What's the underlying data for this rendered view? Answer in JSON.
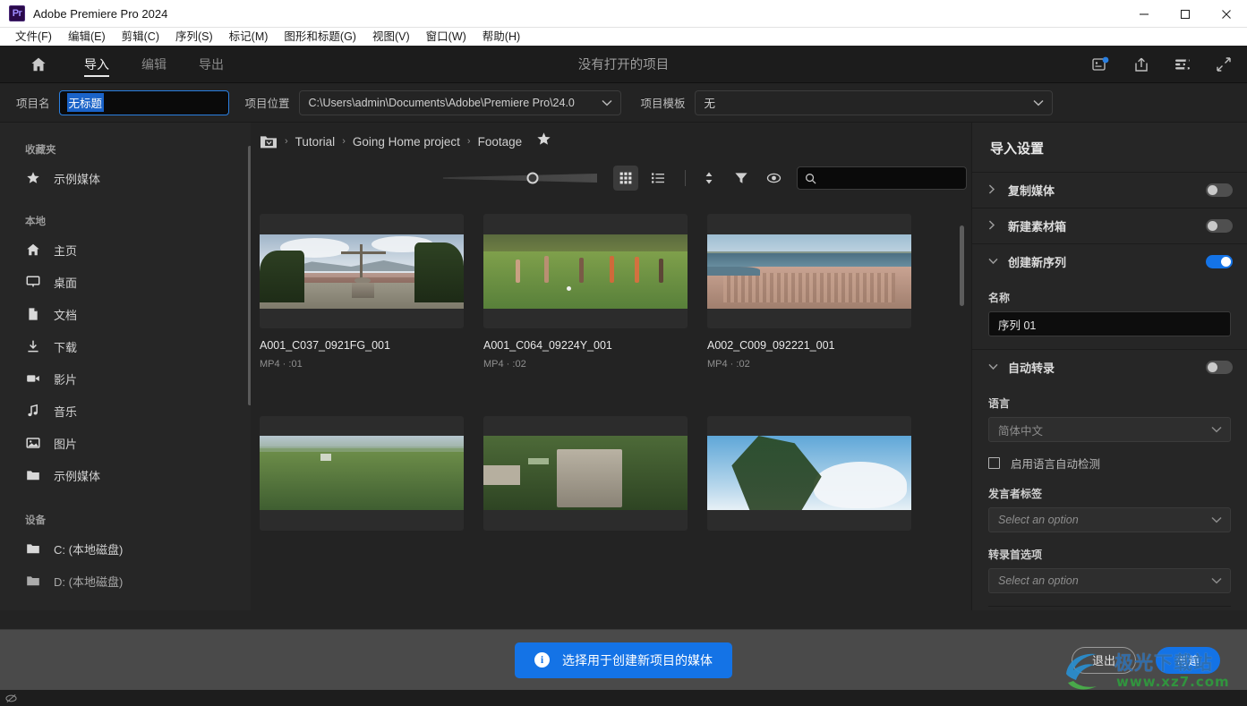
{
  "window": {
    "app_title": "Adobe Premiere Pro 2024",
    "logo_text": "Pr",
    "minimize": "minimize-icon",
    "maximize": "maximize-icon",
    "close": "close-icon"
  },
  "menubar": {
    "items": [
      {
        "label": "文件(F)"
      },
      {
        "label": "编辑(E)"
      },
      {
        "label": "剪辑(C)"
      },
      {
        "label": "序列(S)"
      },
      {
        "label": "标记(M)"
      },
      {
        "label": "图形和标题(G)"
      },
      {
        "label": "视图(V)"
      },
      {
        "label": "窗口(W)"
      },
      {
        "label": "帮助(H)"
      }
    ]
  },
  "header": {
    "home_icon": "home-icon",
    "tabs": [
      {
        "label": "导入",
        "active": true
      },
      {
        "label": "编辑",
        "active": false
      },
      {
        "label": "导出",
        "active": false
      }
    ],
    "center_title": "没有打开的项目",
    "right_icons": [
      "notifications-icon",
      "share-icon",
      "progress-icon",
      "fullscreen-icon"
    ]
  },
  "projectbar": {
    "name_label": "项目名",
    "name_value": "无标题",
    "location_label": "项目位置",
    "location_value": "C:\\Users\\admin\\Documents\\Adobe\\Premiere Pro\\24.0",
    "template_label": "项目模板",
    "template_value": "无"
  },
  "sidebar": {
    "sections": [
      {
        "title": "收藏夹",
        "items": [
          {
            "label": "示例媒体",
            "icon": "star-icon"
          }
        ]
      },
      {
        "title": "本地",
        "items": [
          {
            "label": "主页",
            "icon": "home-icon"
          },
          {
            "label": "桌面",
            "icon": "monitor-icon"
          },
          {
            "label": "文档",
            "icon": "document-icon"
          },
          {
            "label": "下载",
            "icon": "download-icon"
          },
          {
            "label": "影片",
            "icon": "video-camera-icon"
          },
          {
            "label": "音乐",
            "icon": "music-note-icon"
          },
          {
            "label": "图片",
            "icon": "image-icon"
          },
          {
            "label": "示例媒体",
            "icon": "folder-icon"
          }
        ]
      },
      {
        "title": "设备",
        "items": [
          {
            "label": "C: (本地磁盘)",
            "icon": "folder-icon"
          },
          {
            "label": "D: (本地磁盘)",
            "icon": "folder-icon"
          }
        ]
      }
    ]
  },
  "browser": {
    "breadcrumb": {
      "folder_icon": "folder-dropdown-icon",
      "parts": [
        "Tutorial",
        "Going Home project",
        "Footage"
      ],
      "separator": "›",
      "star_icon": "star-icon"
    },
    "toolbar": {
      "zoom_slider_value": 58,
      "grid_view_icon": "grid-view-icon",
      "list_view_icon": "list-view-icon",
      "sort_icon": "sort-icon",
      "filter_icon": "filter-icon",
      "preview_icon": "eye-icon",
      "search_icon": "search-icon",
      "search_value": "",
      "search_placeholder": ""
    },
    "items": [
      {
        "name": "A001_C037_0921FG_001",
        "meta": "MP4 · :01",
        "scene": "cross"
      },
      {
        "name": "A001_C064_09224Y_001",
        "meta": "MP4 · :02",
        "scene": "field"
      },
      {
        "name": "A002_C009_092221_001",
        "meta": "MP4 · :02",
        "scene": "aerial"
      },
      {
        "name": "",
        "meta": "",
        "scene": "jungle"
      },
      {
        "name": "",
        "meta": "",
        "scene": "ruins"
      },
      {
        "name": "",
        "meta": "",
        "scene": "treesky"
      }
    ]
  },
  "import_settings": {
    "title": "导入设置",
    "sections": [
      {
        "label": "复制媒体",
        "expanded": false,
        "toggle_on": false,
        "chevron": "chevron-right-icon"
      },
      {
        "label": "新建素材箱",
        "expanded": false,
        "toggle_on": false,
        "chevron": "chevron-right-icon"
      },
      {
        "label": "创建新序列",
        "expanded": true,
        "toggle_on": true,
        "chevron": "chevron-down-icon"
      },
      {
        "label": "自动转录",
        "expanded": true,
        "toggle_on": false,
        "chevron": "chevron-down-icon"
      }
    ],
    "sequence": {
      "name_label": "名称",
      "name_value": "序列 01"
    },
    "transcription": {
      "language_label": "语言",
      "language_value": "简体中文",
      "autodetect_label": "启用语言自动检测",
      "autodetect_checked": false,
      "speaker_label": "发言者标签",
      "speaker_placeholder": "Select an option",
      "prefs_label": "转录首选项",
      "prefs_placeholder": "Select an option"
    }
  },
  "footer": {
    "info_icon": "info-icon",
    "info_text": "选择用于创建新项目的媒体",
    "cancel_label": "退出",
    "create_label": "创建"
  },
  "statusbar": {
    "icon": "eye-off-icon"
  },
  "watermark": {
    "text": "极光下载站",
    "url": "www.xz7.com"
  },
  "colors": {
    "accent": "#1473e6",
    "panel": "#262626",
    "background": "#232323",
    "footer": "#4a4a4a"
  }
}
